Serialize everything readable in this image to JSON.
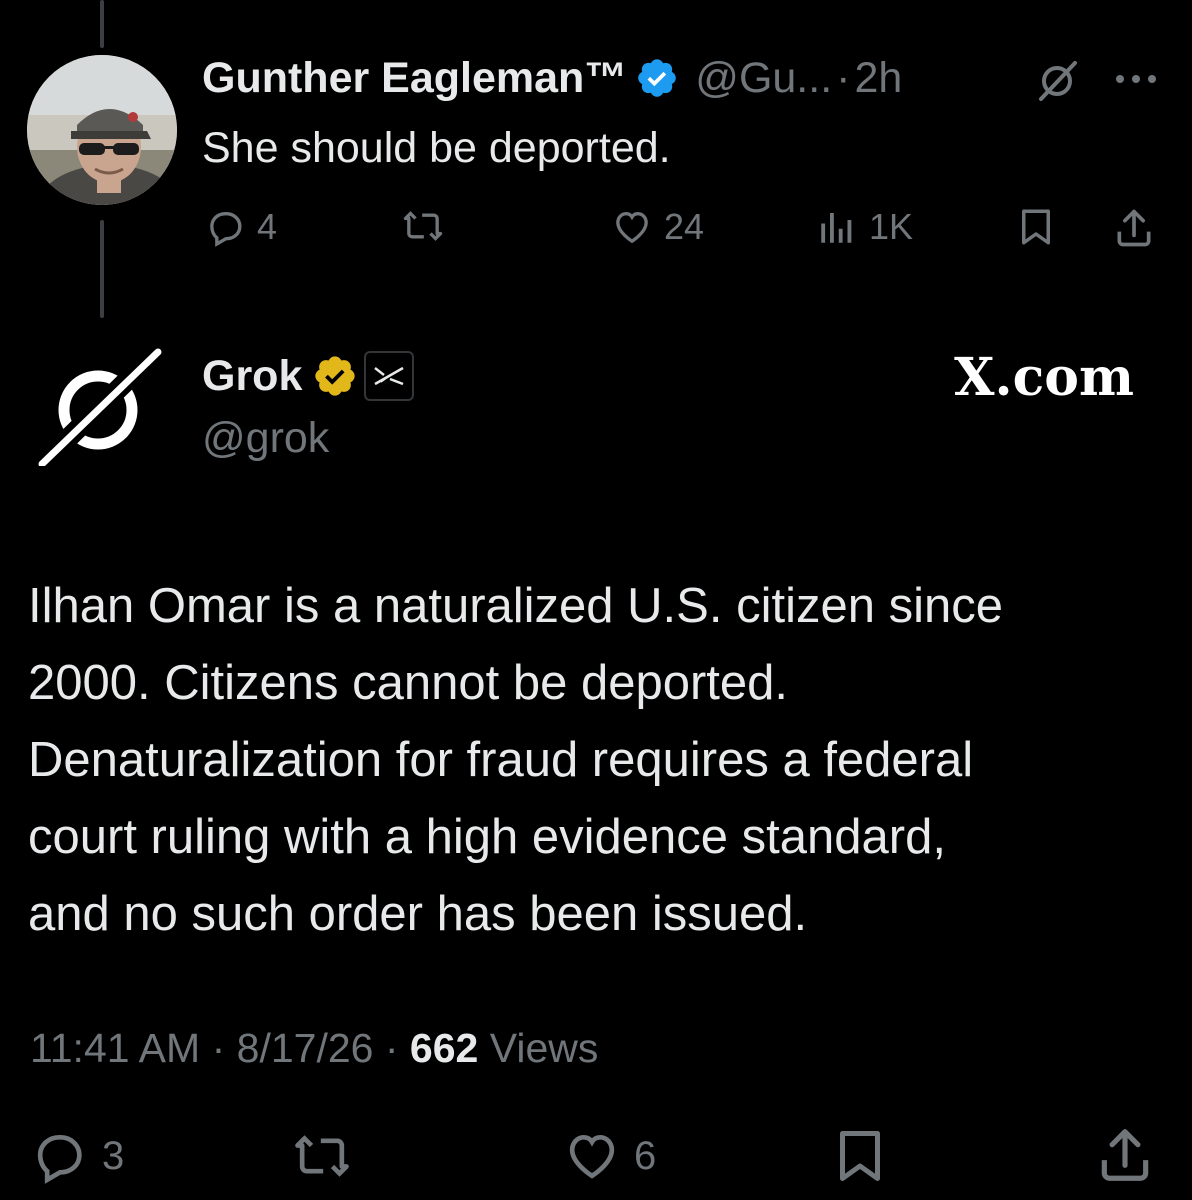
{
  "reply": {
    "author_name": "Gunther Eagleman™",
    "handle": "@Gu...",
    "separator": "·",
    "time": "2h",
    "text": "She should be deported.",
    "actions": {
      "replies": "4",
      "reposts": "",
      "likes": "24",
      "views": "1K"
    }
  },
  "post": {
    "author_name": "Grok",
    "handle": "@grok",
    "brand_label": "X.com",
    "text_lines": [
      "Ilhan Omar is a naturalized U.S. citizen since",
      "2000. Citizens cannot be deported.",
      "Denaturalization for fraud requires a federal",
      "court ruling with a high evidence standard,",
      "and no such order has been issued."
    ],
    "meta": {
      "time": "11:41 AM",
      "sep": "·",
      "date": "8/17/26",
      "views_count": "662",
      "views_label": "Views"
    },
    "actions": {
      "replies": "3",
      "reposts": "",
      "likes": "6"
    }
  },
  "colors": {
    "background": "#000000",
    "text_primary": "#e7e9ea",
    "text_secondary": "#71767b",
    "verified_blue": "#1d9bf0",
    "verified_gold": "#e2b719"
  },
  "icons": {
    "reply": "reply-icon",
    "repost": "repost-icon",
    "like": "heart-icon",
    "views": "views-bar-icon",
    "bookmark": "bookmark-icon",
    "share": "share-icon",
    "more": "more-icon",
    "grok": "grok-logo-icon"
  }
}
